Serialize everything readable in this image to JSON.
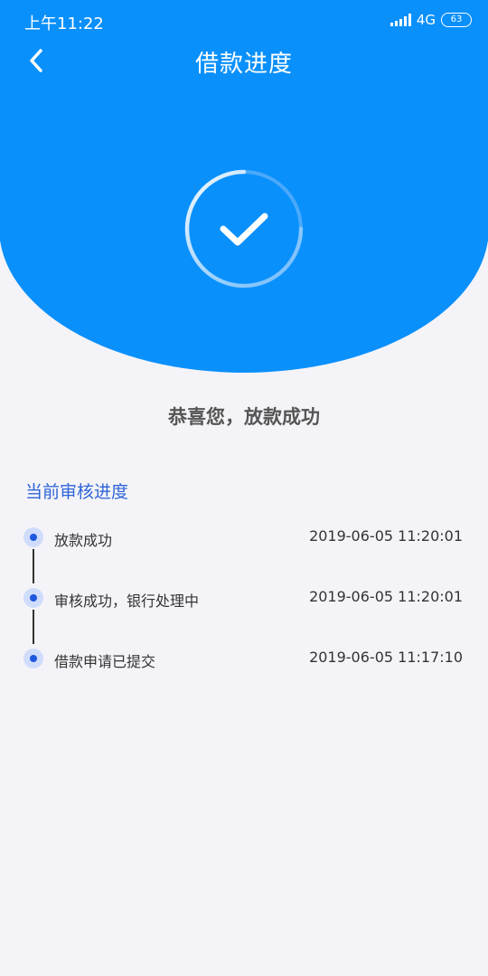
{
  "status_bar": {
    "time": "上午11:22",
    "network": "4G",
    "battery": "63"
  },
  "nav": {
    "title": "借款进度"
  },
  "icons": {
    "back": "chevron-left-icon",
    "success": "checkmark-icon"
  },
  "colors": {
    "primary": "#0a90fb",
    "accent": "#2f64d7",
    "dot": "#1f58e0",
    "background": "#f4f4f8"
  },
  "result": {
    "message": "恭喜您，放款成功"
  },
  "progress": {
    "section_title": "当前审核进度",
    "items": [
      {
        "label": "放款成功",
        "time": "2019-06-05 11:20:01"
      },
      {
        "label": "审核成功，银行处理中",
        "time": "2019-06-05 11:20:01"
      },
      {
        "label": "借款申请已提交",
        "time": "2019-06-05 11:17:10"
      }
    ]
  }
}
